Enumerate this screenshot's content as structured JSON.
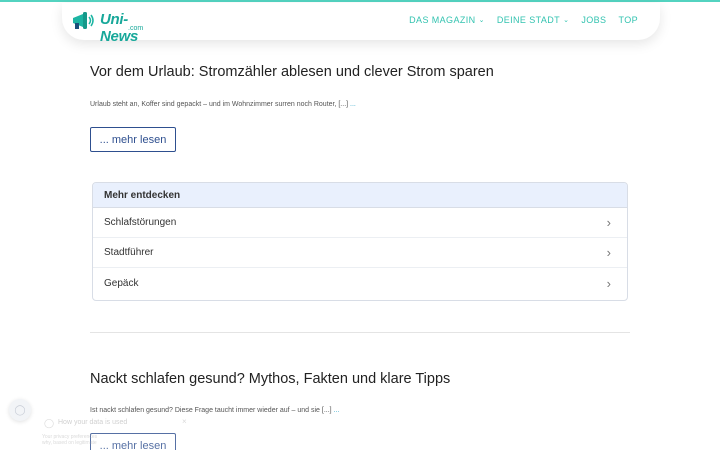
{
  "header": {
    "logo_text": "Uni-News",
    "logo_sub": ".com",
    "nav": [
      {
        "label": "DAS MAGAZIN",
        "dropdown": true
      },
      {
        "label": "DEINE STADT",
        "dropdown": true
      },
      {
        "label": "JOBS",
        "dropdown": false
      },
      {
        "label": "TOP",
        "dropdown": false
      }
    ]
  },
  "posts": [
    {
      "title": "Vor dem Urlaub: Stromzähler ablesen und clever Strom sparen",
      "excerpt": "Urlaub steht an, Koffer sind gepackt – und im Wohnzimmer surren noch Router, [...]",
      "excerpt_more": "...",
      "button": "... mehr lesen"
    },
    {
      "title": "Nackt schlafen gesund? Mythos, Fakten und klare Tipps",
      "excerpt": "Ist nackt schlafen gesund? Diese Frage taucht immer wieder auf – und sie [...]",
      "excerpt_more": "...",
      "button": "... mehr lesen"
    }
  ],
  "discover": {
    "title": "Mehr entdecken",
    "items": [
      "Schlafstörungen",
      "Stadtführer",
      "Gepäck"
    ]
  },
  "privacy": {
    "title": "How your data is used",
    "text_line1": "Your privacy preferences",
    "text_line2": "why, based on legitimate"
  },
  "colors": {
    "accent": "#33c3b0",
    "button_border": "#2e4f8f",
    "discover_header_bg": "#e9f0fd"
  },
  "icons": {
    "logo": "megaphone-icon",
    "nav_dropdown": "chevron-down-icon",
    "row": "chevron-right-icon",
    "privacy": "shield-icon"
  }
}
